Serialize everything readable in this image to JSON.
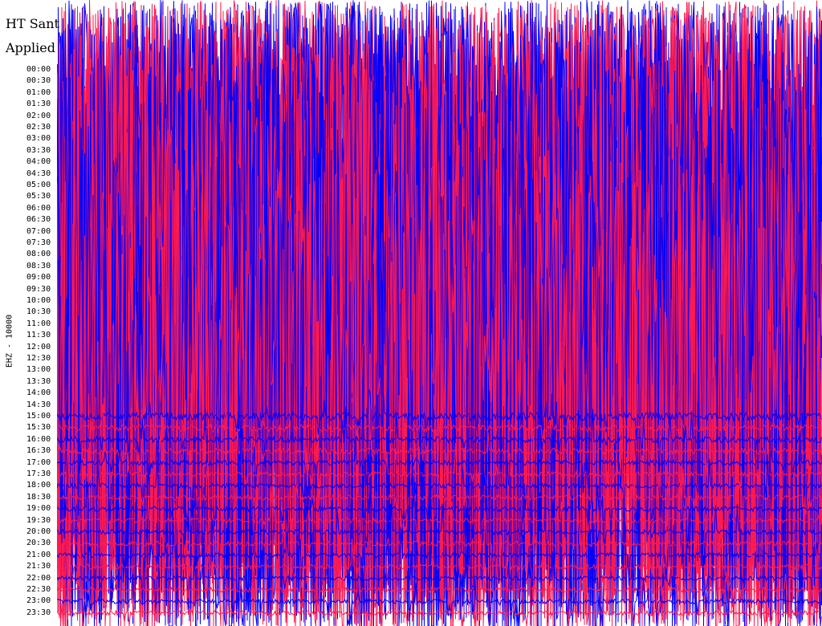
{
  "chart_data": {
    "type": "line",
    "title": "HT Sant",
    "subtitle": "Applied",
    "ylabel": "EHZ - 10000",
    "time_labels": [
      "00:00",
      "00:30",
      "01:00",
      "01:30",
      "02:00",
      "02:30",
      "03:00",
      "03:30",
      "04:00",
      "04:30",
      "05:00",
      "05:30",
      "06:00",
      "06:30",
      "07:00",
      "07:30",
      "08:00",
      "08:30",
      "09:00",
      "09:30",
      "10:00",
      "10:30",
      "11:00",
      "11:30",
      "12:00",
      "12:30",
      "13:00",
      "13:30",
      "14:00",
      "14:30",
      "15:00",
      "15:30",
      "16:00",
      "16:30",
      "17:00",
      "17:30",
      "18:00",
      "18:30",
      "19:00",
      "19:30",
      "20:00",
      "20:30",
      "21:00",
      "21:30",
      "22:00",
      "22:30",
      "23:00",
      "23:30"
    ],
    "trace_colors": [
      "#0000ff",
      "#ff1a4f"
    ],
    "background": "#ffffff",
    "line_amplitude": [
      1.0,
      1.0,
      1.0,
      1.0,
      1.0,
      1.0,
      1.0,
      1.0,
      1.0,
      1.0,
      1.0,
      1.0,
      1.0,
      1.0,
      1.0,
      1.0,
      1.0,
      1.0,
      1.0,
      1.0,
      1.0,
      1.0,
      1.0,
      1.0,
      1.0,
      1.0,
      1.0,
      0.95,
      0.85,
      0.6,
      0.45,
      0.38,
      0.34,
      0.32,
      0.3,
      0.28,
      0.28,
      0.28,
      0.27,
      0.27,
      0.27,
      0.27,
      0.27,
      0.26,
      0.26,
      0.26,
      0.26,
      0.26
    ]
  }
}
